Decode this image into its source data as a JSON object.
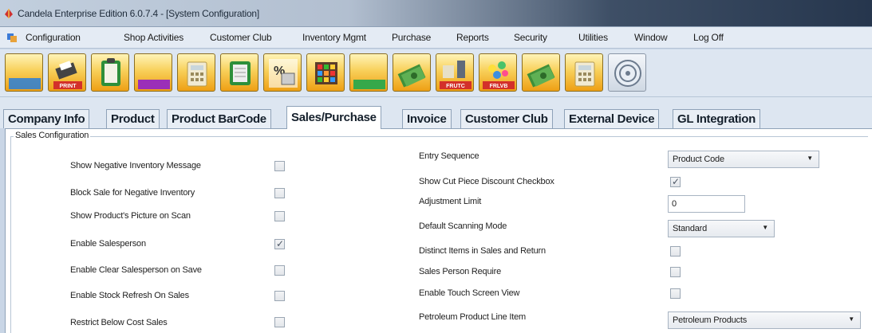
{
  "window": {
    "title": "Candela Enterprise Edition 6.0.7.4 - [System Configuration]"
  },
  "menu": [
    "Configuration",
    "Shop Activities",
    "Customer Club",
    "Inventory Mgmt",
    "Purchase",
    "Reports",
    "Security",
    "Utilities",
    "Window",
    "Log Off"
  ],
  "toolbar": {
    "icons": [
      "folder-icon",
      "print-icon",
      "clipboard-icon",
      "folder-icon",
      "calculator-icon",
      "notepad-icon",
      "percent-icon",
      "calendar-icon",
      "folder-icon",
      "money-icon",
      "fruit-icon",
      "fruit-icon",
      "money-icon",
      "calculator-icon",
      "disk-icon"
    ],
    "print_label": "PRINT",
    "frutc_label": "FRUTC",
    "fruit2_label": "FRLVB"
  },
  "tabs": [
    "Company Info",
    "Product",
    "Product BarCode",
    "Sales/Purchase",
    "Invoice",
    "Customer Club",
    "External Device",
    "GL Integration"
  ],
  "active_tab": "Sales/Purchase",
  "sales_config": {
    "title": "Sales Configuration",
    "left": [
      {
        "label": "Show Negative Inventory Message",
        "checked": false
      },
      {
        "label": "Block Sale for Negative Inventory",
        "checked": false
      },
      {
        "label": "Show Product's Picture on Scan",
        "checked": false
      },
      {
        "label": "Enable Salesperson",
        "checked": true
      },
      {
        "label": "Enable Clear Salesperson on Save",
        "checked": false
      },
      {
        "label": "Enable Stock Refresh On Sales",
        "checked": false
      },
      {
        "label": "Restrict Below Cost Sales",
        "checked": false
      }
    ],
    "entry_sequence": {
      "label": "Entry Sequence",
      "value": "Product Code"
    },
    "show_cut_piece": {
      "label": "Show Cut Piece Discount Checkbox",
      "checked": true
    },
    "adjustment_limit": {
      "label": "Adjustment Limit",
      "value": "0"
    },
    "default_scanning_mode": {
      "label": "Default Scanning Mode",
      "value": "Standard"
    },
    "distinct_items": {
      "label": "Distinct Items in Sales and Return",
      "checked": false
    },
    "sales_person_require": {
      "label": "Sales Person Require",
      "checked": false
    },
    "touch_screen": {
      "label": "Enable Touch Screen View",
      "checked": false
    },
    "petroleum": {
      "label": "Petroleum Product Line Item",
      "value": "Petroleum Products"
    }
  }
}
